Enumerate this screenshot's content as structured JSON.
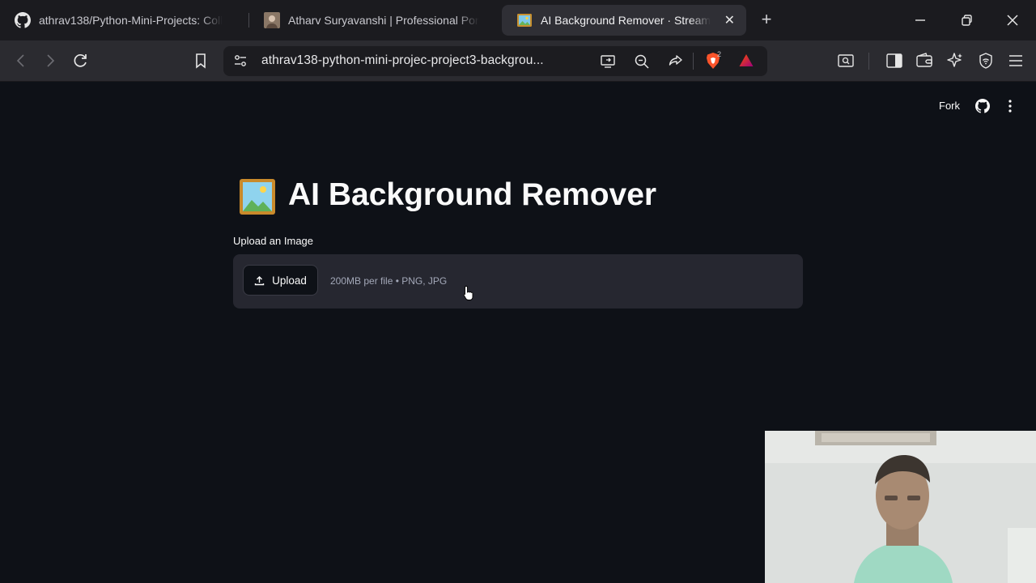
{
  "browser": {
    "tabs": [
      {
        "title": "athrav138/Python-Mini-Projects: Coll",
        "icon": "github-icon",
        "active": false
      },
      {
        "title": "Atharv Suryavanshi | Professional Por",
        "icon": "profile-photo-icon",
        "active": false
      },
      {
        "title": "AI Background Remover · Stream",
        "icon": "framed-picture-icon",
        "active": true
      }
    ],
    "address": "athrav138-python-mini-projec-project3-backgrou...",
    "shields_count": "2"
  },
  "app": {
    "header": {
      "fork_label": "Fork"
    },
    "title_emoji": "🖼️",
    "title": "AI Background Remover",
    "uploader": {
      "label": "Upload an Image",
      "button_label": "Upload",
      "limits": "200MB per file • PNG, JPG"
    }
  },
  "colors": {
    "page_background": "#0e1117",
    "dropzone_background": "#262730",
    "text_primary": "#fafafa",
    "text_muted": "#a3a8b8",
    "tab_strip": "#1b1b1f",
    "toolbar": "#2b2b30",
    "brave_orange": "#fb542b"
  }
}
